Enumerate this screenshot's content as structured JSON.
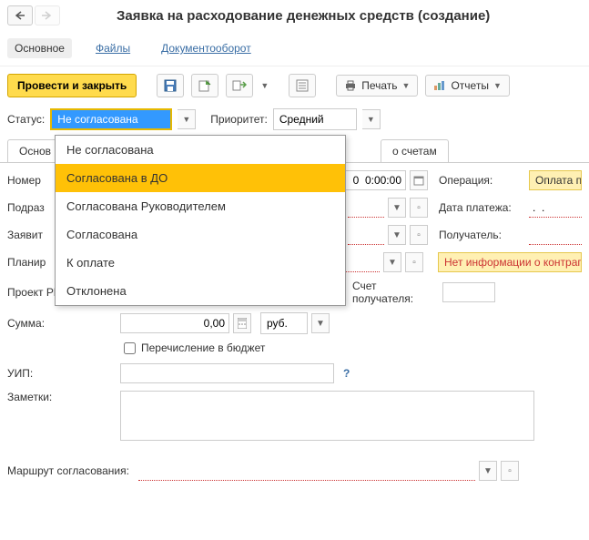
{
  "nav": {
    "back": "←",
    "forward": "→"
  },
  "title": "Заявка на расходование денежных средств (создание)",
  "linkTabs": {
    "main": "Основное",
    "files": "Файлы",
    "doc": "Документооборот"
  },
  "toolbar": {
    "submit": "Провести и закрыть",
    "print": "Печать",
    "reports": "Отчеты"
  },
  "status": {
    "label": "Статус:",
    "value": "Не согласована",
    "priorityLabel": "Приоритет:",
    "priorityValue": "Средний",
    "options": [
      "Не согласована",
      "Согласована в ДО",
      "Согласована Руководителем",
      "Согласована",
      "К оплате",
      "Отклонена"
    ]
  },
  "formTabs": {
    "t1": "Основ",
    "t2": "о счетам"
  },
  "form": {
    "numberLabel": "Номер",
    "dateValue": "0  0:00:00",
    "operationLabel": "Операция:",
    "operationValue": "Оплата п",
    "podrLabel": "Подраз",
    "payDateLabel": "Дата платежа:",
    "payDateValue": ".  .",
    "applicantLabel": "Заявит",
    "recipientLabel": "Получатель:",
    "planLabel": "Планир",
    "warn": "Нет информации о контраг",
    "projectLabel": "Проект РМ (СБ):",
    "accountLabel": "Счет получателя:",
    "sumLabel": "Сумма:",
    "sumValue": "0,00",
    "currency": "руб.",
    "budgetCheck": "Перечисление в бюджет",
    "uipLabel": "УИП:",
    "notesLabel": "Заметки:",
    "routeLabel": "Маршрут согласования:"
  }
}
